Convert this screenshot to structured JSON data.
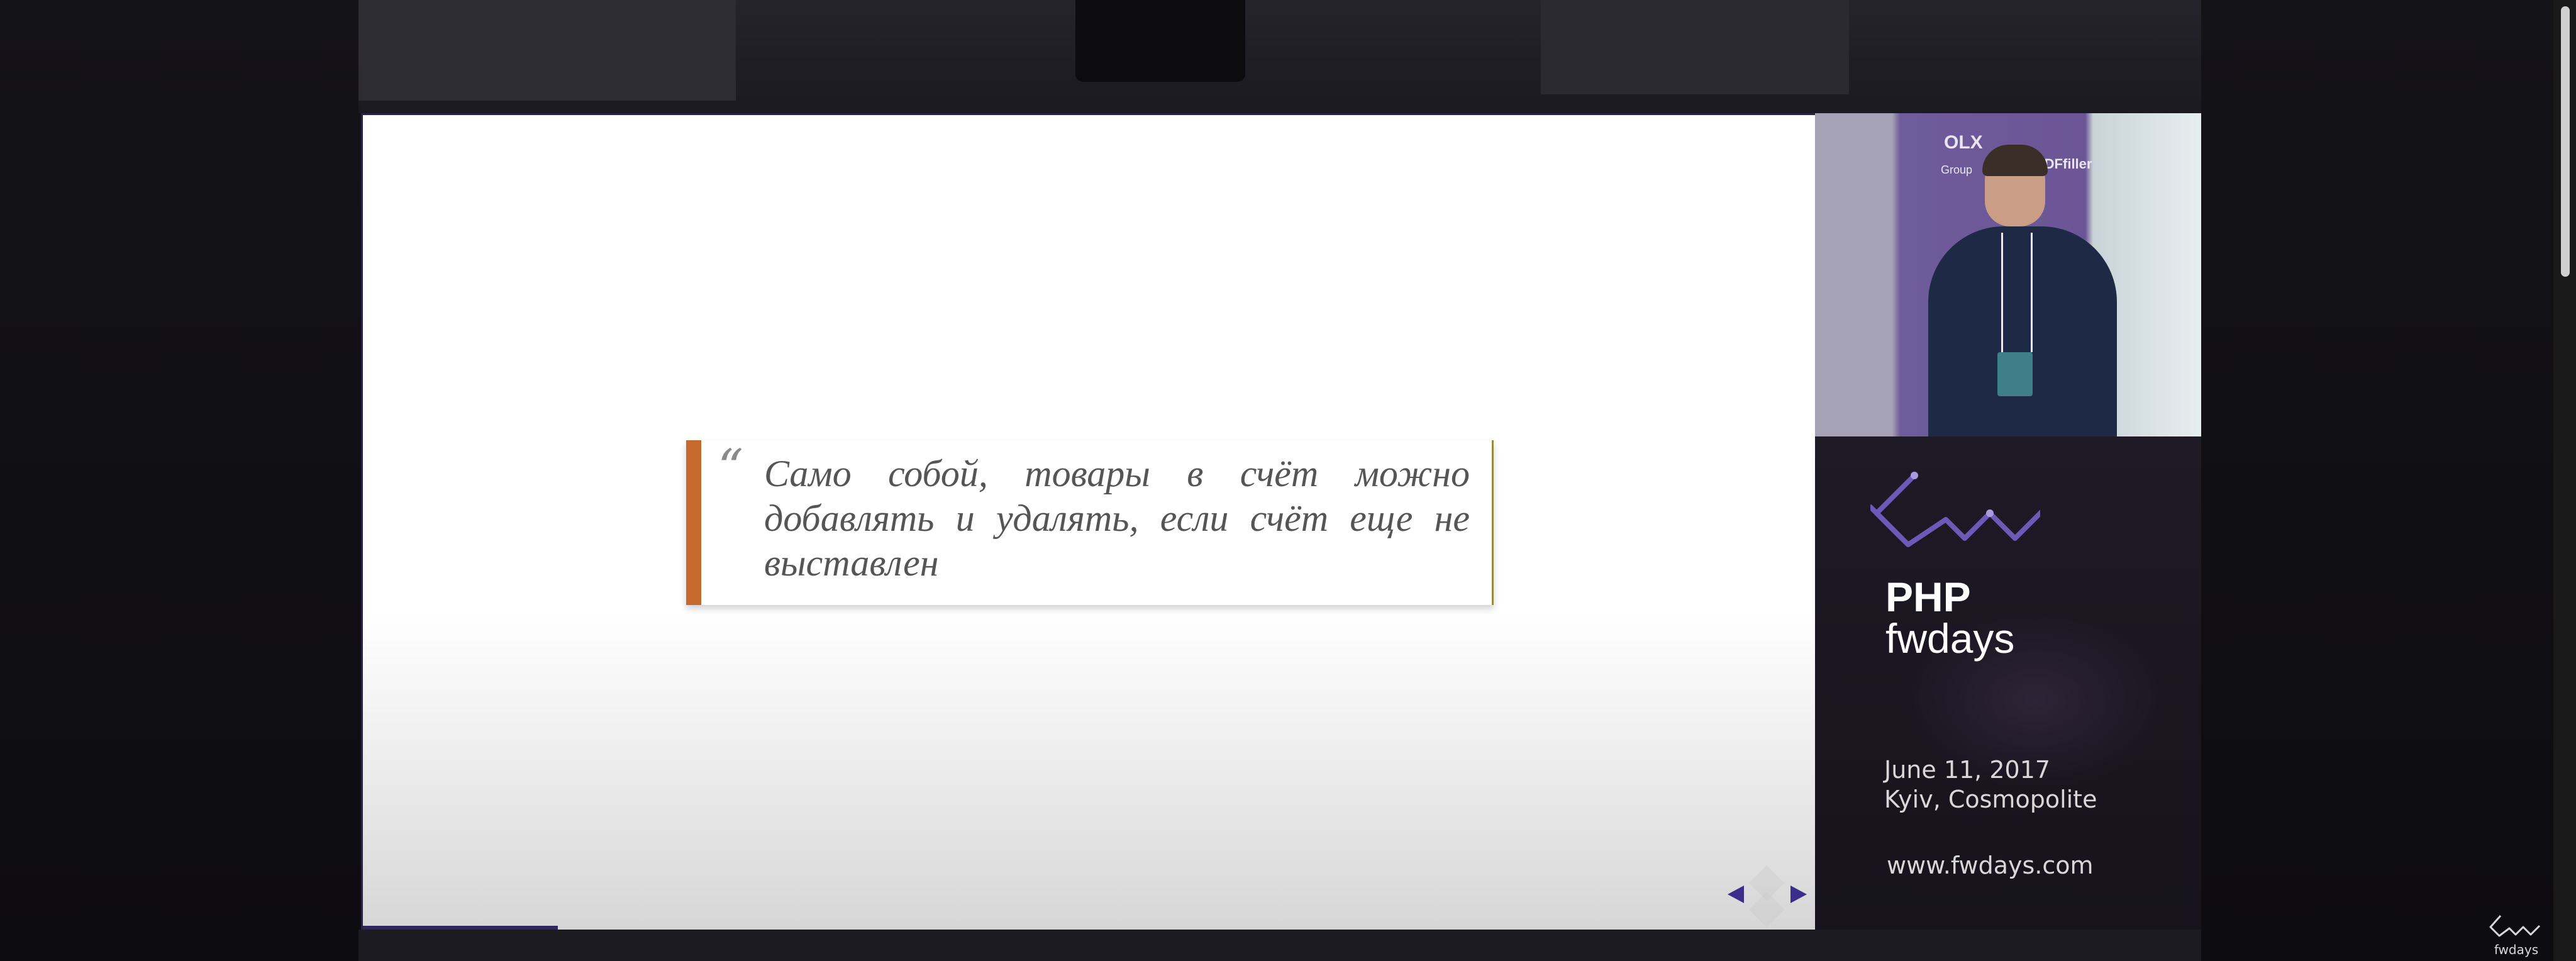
{
  "slide": {
    "quote": "Само собой, товары в счёт можно добавлять и удалять, если счёт еще не выставлен",
    "quote_mark": "“",
    "nav": {
      "prev_icon": "arrow-left-icon",
      "next_icon": "arrow-right-icon"
    }
  },
  "event": {
    "title_line1": "PHP",
    "title_line2": "fwdays",
    "date": "June 11, 2017",
    "venue": "Kyiv, Cosmopolite",
    "website": "www.fwdays.com"
  },
  "video": {
    "banner_text_1": "OLX",
    "banner_text_2": "Group",
    "banner_text_3": "PDFfiller"
  },
  "corner_logo": {
    "label": "fwdays"
  },
  "colors": {
    "quote_accent": "#c46a2a",
    "nav_arrows": "#3b2d8a",
    "logo_line": "#6c5ab8"
  }
}
